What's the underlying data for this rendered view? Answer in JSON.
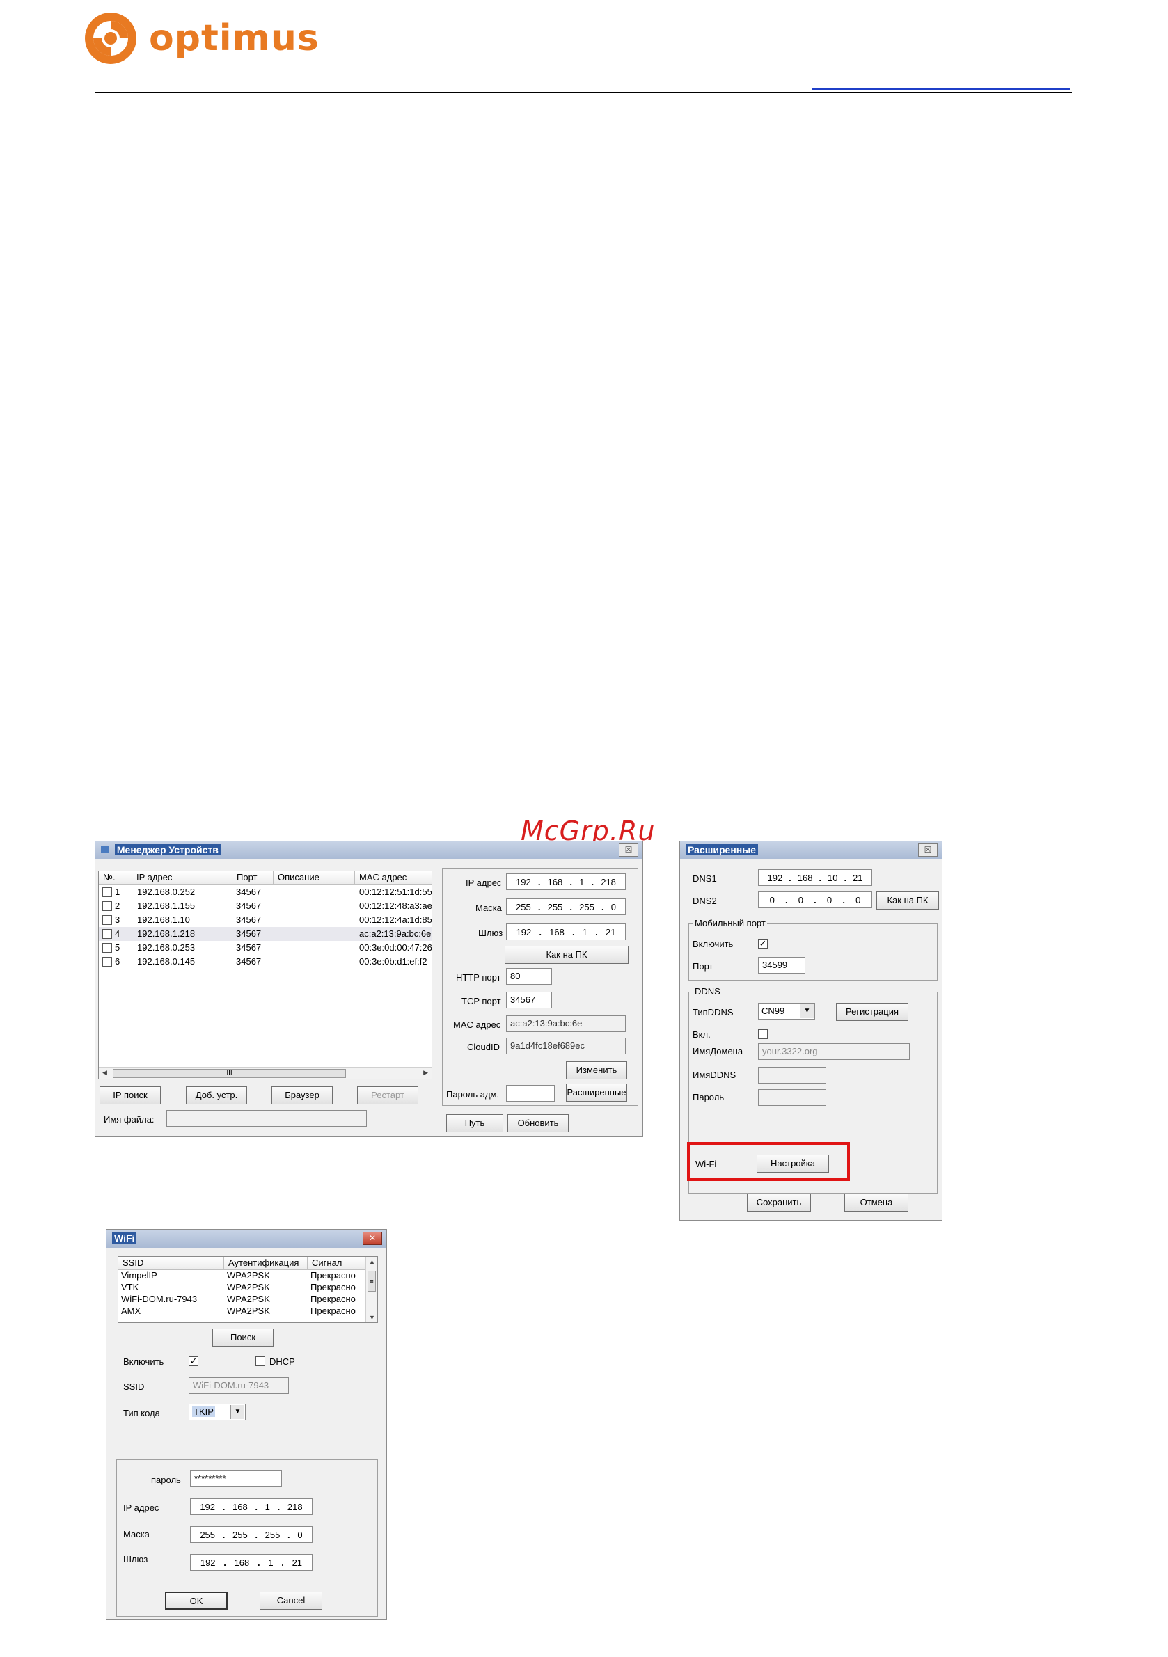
{
  "brand": {
    "name": "optimus",
    "color": "#e87a22"
  },
  "watermark": "McGrp.Ru",
  "device_manager": {
    "title": "Менеджер Устройств",
    "close": "☒",
    "columns": [
      "№.",
      "IP адрес",
      "Порт",
      "Описание",
      "MAC адрес"
    ],
    "rows": [
      {
        "n": "1",
        "ip": "192.168.0.252",
        "port": "34567",
        "desc": "",
        "mac": "00:12:12:51:1d:55"
      },
      {
        "n": "2",
        "ip": "192.168.1.155",
        "port": "34567",
        "desc": "",
        "mac": "00:12:12:48:a3:ae"
      },
      {
        "n": "3",
        "ip": "192.168.1.10",
        "port": "34567",
        "desc": "",
        "mac": "00:12:12:4a:1d:85"
      },
      {
        "n": "4",
        "ip": "192.168.1.218",
        "port": "34567",
        "desc": "",
        "mac": "ac:a2:13:9a:bc:6e"
      },
      {
        "n": "5",
        "ip": "192.168.0.253",
        "port": "34567",
        "desc": "",
        "mac": "00:3e:0d:00:47:26"
      },
      {
        "n": "6",
        "ip": "192.168.0.145",
        "port": "34567",
        "desc": "",
        "mac": "00:3e:0b:d1:ef:f2"
      }
    ],
    "scroll_thumb": "III",
    "buttons": {
      "ip_search": "IP поиск",
      "add_device": "Доб. устр.",
      "browser": "Браузер",
      "restart": "Рестарт",
      "as_pc": "Как на ПК",
      "change": "Изменить",
      "advanced": "Расширенные",
      "path": "Путь",
      "refresh": "Обновить"
    },
    "file_label": "Имя файла:",
    "ip_label": "IP адрес",
    "ip": [
      "192",
      "168",
      "1",
      "218"
    ],
    "mask_label": "Маска",
    "mask": [
      "255",
      "255",
      "255",
      "0"
    ],
    "gateway_label": "Шлюз",
    "gateway": [
      "192",
      "168",
      "1",
      "21"
    ],
    "http_label": "HTTP порт",
    "http": "80",
    "tcp_label": "TCP порт",
    "tcp": "34567",
    "mac_label": "MAC адрес",
    "mac": "ac:a2:13:9a:bc:6e",
    "cloud_label": "CloudID",
    "cloud": "9a1d4fc18ef689ec",
    "admin_pass_label": "Пароль адм."
  },
  "advanced": {
    "title": "Расширенные",
    "close": "☒",
    "dns1_label": "DNS1",
    "dns1": [
      "192",
      "168",
      "10",
      "21"
    ],
    "dns2_label": "DNS2",
    "dns2": [
      "0",
      "0",
      "0",
      "0"
    ],
    "as_pc": "Как на ПК",
    "mobile_group": "Мобильный порт",
    "enable_label": "Включить",
    "enable_checked": "✓",
    "port_label": "Порт",
    "port": "34599",
    "ddns_group": "DDNS",
    "ddns_type_label": "ТипDDNS",
    "ddns_type": "CN99",
    "register": "Регистрация",
    "on_label": "Вкл.",
    "domain_label": "ИмяДомена",
    "domain_placeholder": "your.3322.org",
    "ddns_name_label": "ИмяDDNS",
    "password_label": "Пароль",
    "wifi_label": "Wi-Fi",
    "wifi_setup": "Настройка",
    "save": "Сохранить",
    "cancel": "Отмена"
  },
  "wifi": {
    "title": "WiFi",
    "close": "✕",
    "columns": [
      "SSID",
      "Аутентификация",
      "Сигнал"
    ],
    "rows": [
      {
        "ssid": "VimpelIP",
        "auth": "WPA2PSK",
        "signal": "Прекрасно"
      },
      {
        "ssid": "VTK",
        "auth": "WPA2PSK",
        "signal": "Прекрасно"
      },
      {
        "ssid": "WiFi-DOM.ru-7943",
        "auth": "WPA2PSK",
        "signal": "Прекрасно"
      },
      {
        "ssid": "AMX",
        "auth": "WPA2PSK",
        "signal": "Прекрасно"
      }
    ],
    "search": "Поиск",
    "enable_label": "Включить",
    "enable_checked": "✓",
    "dhcp_label": "DHCP",
    "ssid_label": "SSID",
    "ssid_value": "WiFi-DOM.ru-7943",
    "code_type_label": "Тип кода",
    "code_type": "TKIP",
    "password_label": "пароль",
    "password": "*********",
    "ip_label": "IP адрес",
    "ip": [
      "192",
      "168",
      "1",
      "218"
    ],
    "mask_label": "Маска",
    "mask": [
      "255",
      "255",
      "255",
      "0"
    ],
    "gateway_label": "Шлюз",
    "gateway": [
      "192",
      "168",
      "1",
      "21"
    ],
    "ok": "OK",
    "cancel": "Cancel"
  }
}
